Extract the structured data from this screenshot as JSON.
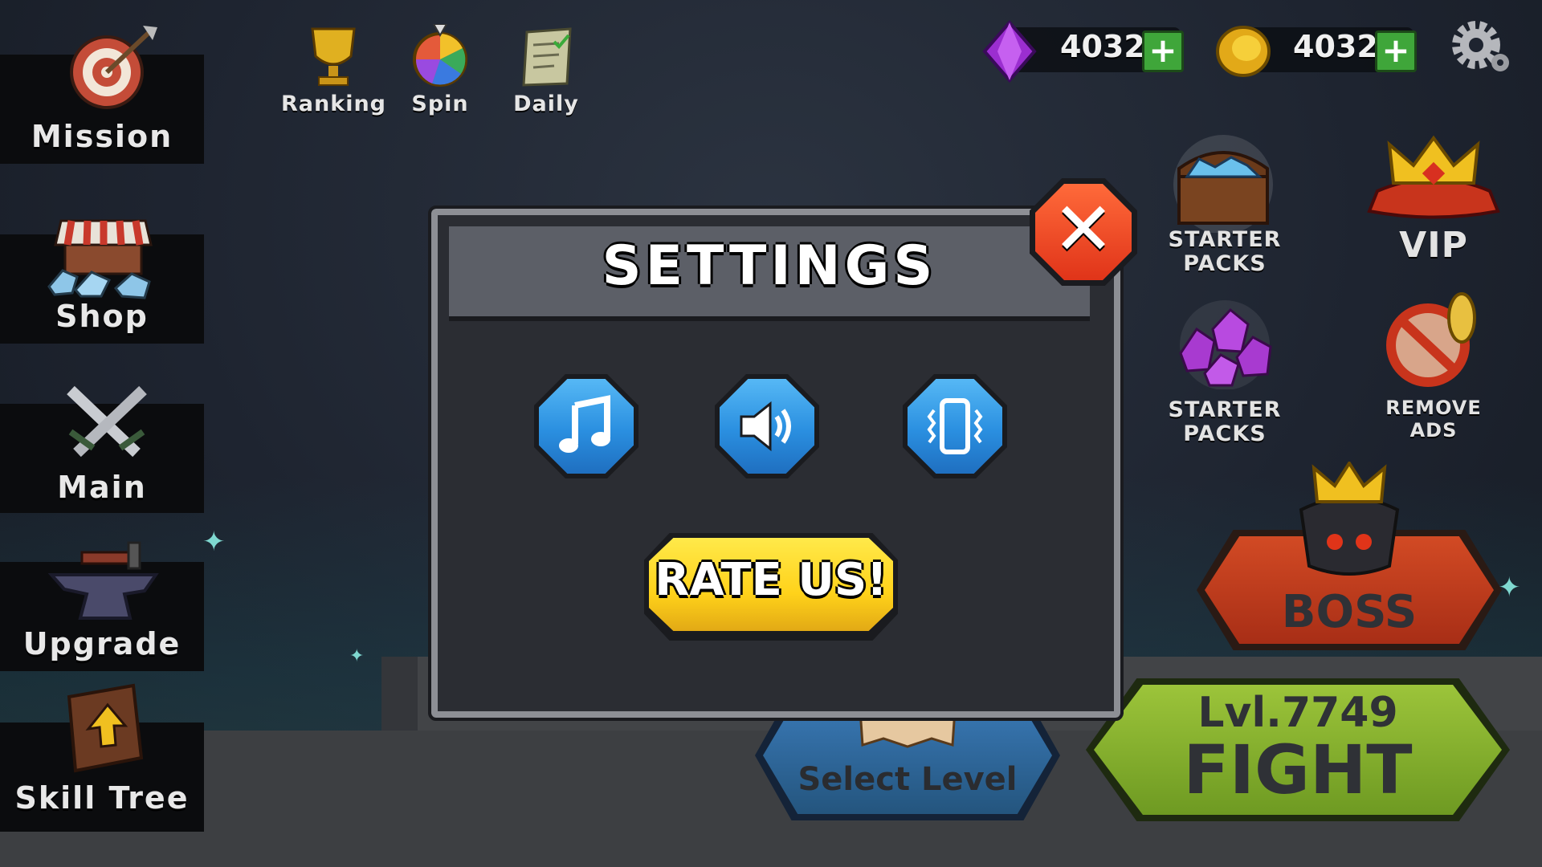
{
  "side_menu": [
    {
      "label": "Mission",
      "icon": "target-icon"
    },
    {
      "label": "Shop",
      "icon": "shop-icon"
    },
    {
      "label": "Main",
      "icon": "crossed-swords-icon"
    },
    {
      "label": "Upgrade",
      "icon": "anvil-icon"
    },
    {
      "label": "Skill Tree",
      "icon": "book-icon"
    }
  ],
  "top_bar": {
    "ranking": "Ranking",
    "spin": "Spin",
    "daily": "Daily"
  },
  "currency": {
    "gems": "4032",
    "coins": "4032",
    "plus": "+"
  },
  "right_panel": {
    "starter_packs_1": [
      "STARTER",
      "PACKS"
    ],
    "vip": "VIP",
    "starter_packs_2": [
      "STARTER",
      "PACKS"
    ],
    "remove_ads": [
      "REMOVE",
      "ADS"
    ],
    "boss": "BOSS",
    "level": "Lvl.7749",
    "fight": "FIGHT",
    "select_level": "Select Level"
  },
  "settings": {
    "title": "SETTINGS",
    "rate_us": "RATE US!",
    "close": "✕"
  },
  "colors": {
    "modal_bg": "#2b2d33",
    "button_blue": "#2a8fe0",
    "rate_yellow": "#ffd21a",
    "close_red": "#e03419",
    "boss_red": "#b23a1f",
    "fight_green": "#7da42a"
  }
}
